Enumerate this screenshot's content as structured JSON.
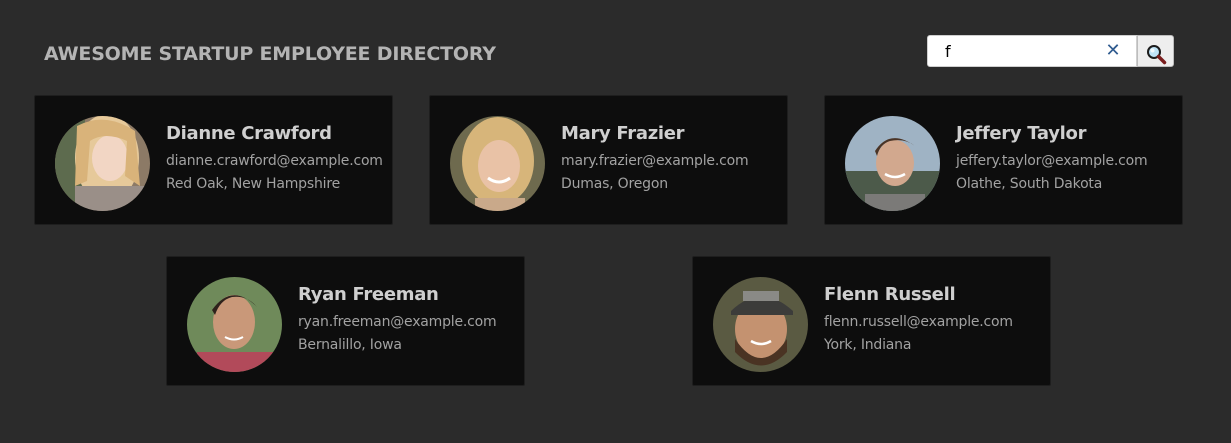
{
  "header": {
    "title": "AWESOME STARTUP EMPLOYEE DIRECTORY"
  },
  "search": {
    "value": "f",
    "clear_icon": "close-icon",
    "button_icon": "magnifier-icon"
  },
  "employees": [
    {
      "name": "Dianne Crawford",
      "email": "dianne.crawford@example.com",
      "location": "Red Oak, New Hampshire"
    },
    {
      "name": "Mary Frazier",
      "email": "mary.frazier@example.com",
      "location": "Dumas, Oregon"
    },
    {
      "name": "Jeffery Taylor",
      "email": "jeffery.taylor@example.com",
      "location": "Olathe, South Dakota"
    },
    {
      "name": "Ryan Freeman",
      "email": "ryan.freeman@example.com",
      "location": "Bernalillo, Iowa"
    },
    {
      "name": "Flenn Russell",
      "email": "flenn.russell@example.com",
      "location": "York, Indiana"
    }
  ],
  "colors": {
    "background": "#2b2b2b",
    "card": "#0d0d0d",
    "name_text": "#cfcfcf",
    "detail_text": "#a2a2a2",
    "clear_icon": "#2f5b8f"
  }
}
